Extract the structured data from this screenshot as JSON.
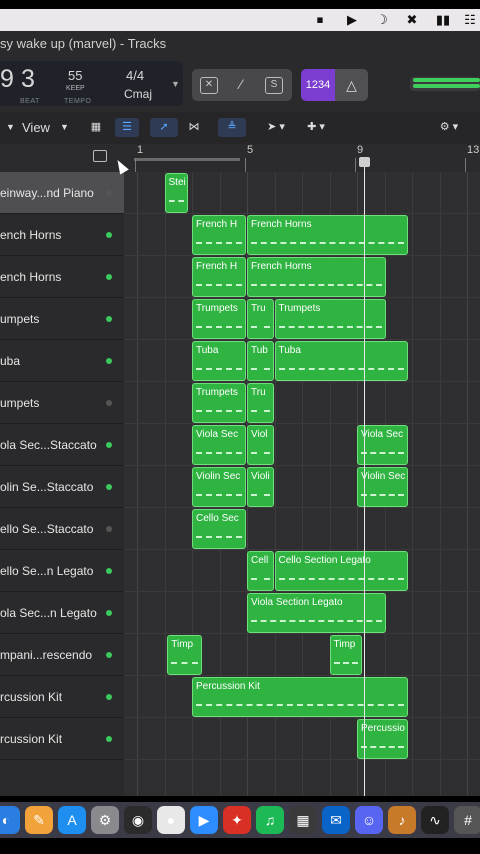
{
  "window": {
    "title": "sy wake up (marvel) - Tracks"
  },
  "menubar": {
    "icons": [
      "stop-record-icon",
      "play-icon",
      "moon-icon",
      "mute-icon",
      "battery-icon",
      "control-center-icon"
    ]
  },
  "lcd": {
    "bar": "9",
    "beat": "3",
    "beat_label": "BEAT",
    "tempo": "55",
    "keep_label": "KEEP",
    "tempo_label": "TEMPO",
    "time_signature": "4/4",
    "key": "Cmaj"
  },
  "controls": {
    "count_in": "1234"
  },
  "toolbar": {
    "view_label": "View"
  },
  "ruler": {
    "markers": [
      "1",
      "5",
      "9",
      "13"
    ]
  },
  "colors": {
    "region": "#2fb341",
    "active_dot": "#3ac95a",
    "muted_dot": "#555555",
    "accent": "#5aa8ff"
  },
  "tracks": [
    {
      "name": "einway...nd Piano",
      "active": false
    },
    {
      "name": "ench Horns",
      "active": true
    },
    {
      "name": "ench Horns",
      "active": true
    },
    {
      "name": "umpets",
      "active": true
    },
    {
      "name": "uba",
      "active": true
    },
    {
      "name": "umpets",
      "active": false
    },
    {
      "name": "ola Sec...Staccato",
      "active": true
    },
    {
      "name": "olin Se...Staccato",
      "active": true
    },
    {
      "name": "ello Se...Staccato",
      "active": false
    },
    {
      "name": "ello Se...n Legato",
      "active": true
    },
    {
      "name": "ola Sec...n Legato",
      "active": true
    },
    {
      "name": "mpani...rescendo",
      "active": true
    },
    {
      "name": "rcussion Kit",
      "active": true
    },
    {
      "name": "rcussion Kit",
      "active": true
    }
  ],
  "regions": [
    {
      "track": 0,
      "start_bar": 2.0,
      "end_bar": 2.9,
      "label": "Stei"
    },
    {
      "track": 1,
      "start_bar": 3.0,
      "end_bar": 5.0,
      "label": "French H"
    },
    {
      "track": 1,
      "start_bar": 5.0,
      "end_bar": 10.9,
      "label": "French Horns"
    },
    {
      "track": 2,
      "start_bar": 3.0,
      "end_bar": 5.0,
      "label": "French H"
    },
    {
      "track": 2,
      "start_bar": 5.0,
      "end_bar": 10.1,
      "label": "French Horns"
    },
    {
      "track": 3,
      "start_bar": 3.0,
      "end_bar": 5.0,
      "label": "Trumpets"
    },
    {
      "track": 3,
      "start_bar": 5.0,
      "end_bar": 6.0,
      "label": "Tru"
    },
    {
      "track": 3,
      "start_bar": 6.0,
      "end_bar": 10.1,
      "label": "Trumpets"
    },
    {
      "track": 4,
      "start_bar": 3.0,
      "end_bar": 5.0,
      "label": "Tuba"
    },
    {
      "track": 4,
      "start_bar": 5.0,
      "end_bar": 6.0,
      "label": "Tub"
    },
    {
      "track": 4,
      "start_bar": 6.0,
      "end_bar": 10.9,
      "label": "Tuba"
    },
    {
      "track": 5,
      "start_bar": 3.0,
      "end_bar": 5.0,
      "label": "Trumpets"
    },
    {
      "track": 5,
      "start_bar": 5.0,
      "end_bar": 6.0,
      "label": "Tru"
    },
    {
      "track": 6,
      "start_bar": 3.0,
      "end_bar": 5.0,
      "label": "Viola Sec"
    },
    {
      "track": 6,
      "start_bar": 5.0,
      "end_bar": 6.0,
      "label": "Viol"
    },
    {
      "track": 6,
      "start_bar": 9.0,
      "end_bar": 10.9,
      "label": "Viola Sec"
    },
    {
      "track": 7,
      "start_bar": 3.0,
      "end_bar": 5.0,
      "label": "Violin Sec"
    },
    {
      "track": 7,
      "start_bar": 5.0,
      "end_bar": 6.0,
      "label": "Violi"
    },
    {
      "track": 7,
      "start_bar": 9.0,
      "end_bar": 10.9,
      "label": "Violin Sec"
    },
    {
      "track": 8,
      "start_bar": 3.0,
      "end_bar": 5.0,
      "label": "Cello Sec"
    },
    {
      "track": 9,
      "start_bar": 5.0,
      "end_bar": 6.0,
      "label": "Cell"
    },
    {
      "track": 9,
      "start_bar": 6.0,
      "end_bar": 10.9,
      "label": "Cello Section Legato"
    },
    {
      "track": 10,
      "start_bar": 5.0,
      "end_bar": 10.1,
      "label": "Viola Section Legato"
    },
    {
      "track": 11,
      "start_bar": 2.1,
      "end_bar": 3.4,
      "label": "Timp"
    },
    {
      "track": 11,
      "start_bar": 8.0,
      "end_bar": 9.2,
      "label": "Timp"
    },
    {
      "track": 12,
      "start_bar": 3.0,
      "end_bar": 10.9,
      "label": "Percussion Kit"
    },
    {
      "track": 13,
      "start_bar": 9.0,
      "end_bar": 10.9,
      "label": "Percussio"
    }
  ],
  "dock": {
    "icons": [
      "finder-icon",
      "pages-icon",
      "app-store-icon",
      "system-settings-icon",
      "logic-icon",
      "chrome-icon",
      "zoom-icon",
      "acrobat-icon",
      "spotify-icon",
      "final-cut-icon",
      "outlook-icon",
      "discord-icon",
      "garageband-icon",
      "voice-memos-icon",
      "calculator-icon"
    ]
  }
}
